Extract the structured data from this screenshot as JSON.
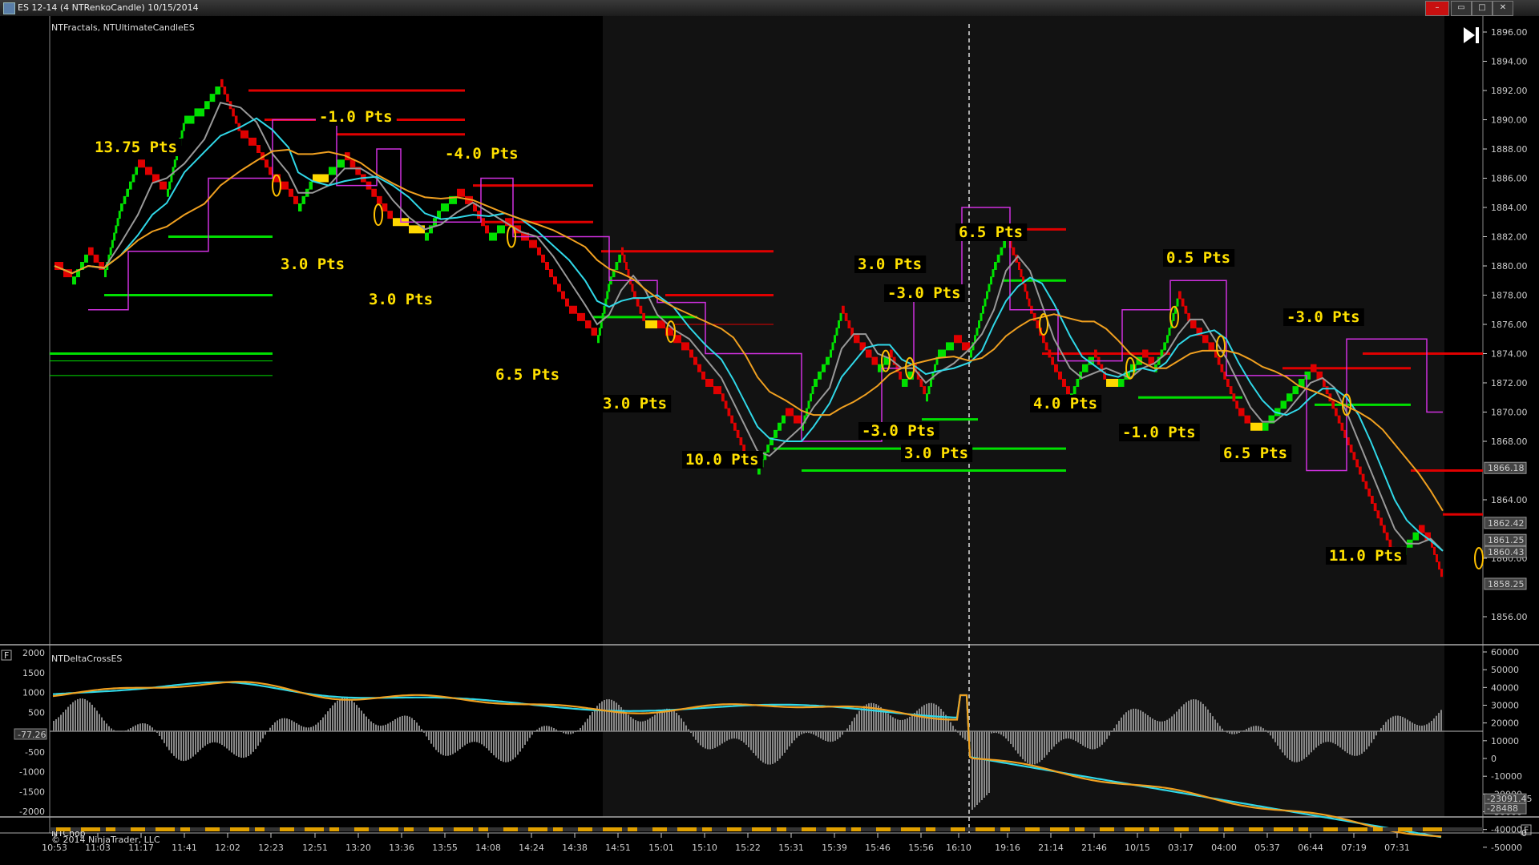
{
  "window": {
    "title": "ES 12-14 (4 NTRenkoCandle)  10/15/2014",
    "btn_close": "–",
    "btn_min": "▭",
    "btn_max": "□",
    "btn_x2": "✕"
  },
  "panels": {
    "price_indicators": "NTFractals, NTUltimateCandleES",
    "delta_indicator": "NTDeltaCrossES",
    "chop_indicator": "NTChop",
    "copyright": "© 2014 NinjaTrader, LLC",
    "panel_toggle": "F",
    "play_icon": "skip-to-end"
  },
  "price_axis": [
    "1896.00",
    "1894.00",
    "1892.00",
    "1890.00",
    "1888.00",
    "1886.00",
    "1884.00",
    "1882.00",
    "1880.00",
    "1878.00",
    "1876.00",
    "1874.00",
    "1872.00",
    "1870.00",
    "1868.00",
    "1864.00",
    "1860.00",
    "1856.00"
  ],
  "price_markers": [
    "1866.18",
    "1862.42",
    "1861.25",
    "1860.43",
    "1858.25"
  ],
  "delta_axis_left": [
    "2000",
    "1500",
    "1000",
    "500",
    "-500",
    "-1000",
    "-1500",
    "-2000"
  ],
  "delta_current": "-77.26",
  "delta_axis_right": [
    "60000",
    "50000",
    "40000",
    "30000",
    "20000",
    "10000",
    "0",
    "-10000",
    "-20000",
    "-30000",
    "-40000",
    "-50000"
  ],
  "delta_markers": [
    "-23091.45",
    "-28488"
  ],
  "chop_axis": "0",
  "time_axis": [
    "10:53",
    "11:03",
    "11:17",
    "11:41",
    "12:02",
    "12:23",
    "12:51",
    "13:20",
    "13:36",
    "13:55",
    "14:08",
    "14:24",
    "14:38",
    "14:51",
    "15:01",
    "15:10",
    "15:22",
    "15:31",
    "15:39",
    "15:46",
    "15:56",
    "16:10",
    "19:16",
    "21:14",
    "21:46",
    "10/15",
    "03:17",
    "04:00",
    "05:37",
    "06:44",
    "07:19",
    "07:31"
  ],
  "trade_labels": [
    "13.75 Pts",
    "-1.0 Pts",
    "-4.0 Pts",
    "3.0 Pts",
    "3.0 Pts",
    "6.5 Pts",
    "3.0 Pts",
    "10.0 Pts",
    "3.0 Pts",
    "-3.0 Pts",
    "-3.0 Pts",
    "3.0 Pts",
    "6.5 Pts",
    "4.0 Pts",
    "0.5 Pts",
    "-1.0 Pts",
    "-3.0 Pts",
    "6.5 Pts",
    "11.0 Pts"
  ],
  "colors": {
    "up": "#00e000",
    "down": "#e00000",
    "neutral": "#ffd800",
    "cyan": "#30d8e8",
    "orange": "#f0a020",
    "magenta": "#d030e0",
    "background": "#000000",
    "shaded": "#121212"
  }
}
